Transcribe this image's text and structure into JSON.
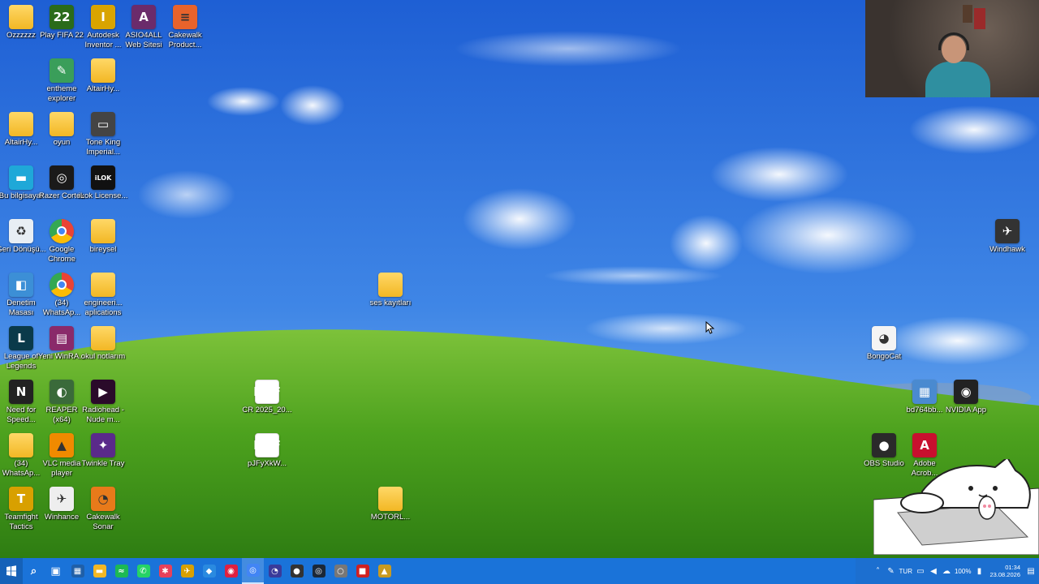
{
  "desktop": {
    "icons": [
      {
        "id": "ozzzzzz",
        "label": "Ozzzzzz",
        "icon": "folder-icon",
        "kind": "folder"
      },
      {
        "id": "fifa22",
        "label": "Play FIFA 22",
        "icon": "fifa-22-icon",
        "glyph": "22",
        "color": "#2a6b1a"
      },
      {
        "id": "autodesk",
        "label": "Autodesk Inventor ...",
        "icon": "autodesk-inventor-icon",
        "glyph": "I",
        "color": "#d9a400"
      },
      {
        "id": "asio4all",
        "label": "ASIO4ALL Web Sitesi",
        "icon": "asio4all-icon",
        "glyph": "A",
        "color": "#6b2b6b"
      },
      {
        "id": "cakewalk-product",
        "label": "Cakewalk Product...",
        "icon": "cakewalk-product-center-icon",
        "glyph": "≡",
        "color": "#e8632b"
      },
      {
        "id": "entheme",
        "label": "entheme explorer",
        "icon": "explorer-icon",
        "glyph": "✎",
        "color": "#3a9e5a"
      },
      {
        "id": "altair-hy-1",
        "label": "AltairHy...",
        "icon": "folder-icon",
        "kind": "folder"
      },
      {
        "id": "altair-hy-2",
        "label": "AltairHy...",
        "icon": "folder-icon",
        "kind": "folder"
      },
      {
        "id": "oyun",
        "label": "oyun",
        "icon": "folder-icon",
        "kind": "folder"
      },
      {
        "id": "toneking",
        "label": "Tone King Imperial...",
        "icon": "tone-king-amp-icon",
        "glyph": "▭",
        "color": "#444"
      },
      {
        "id": "bu-bilgisayar",
        "label": "Bu bilgisayar",
        "icon": "this-pc-icon",
        "glyph": "▬",
        "color": "#1fa8d8"
      },
      {
        "id": "razer",
        "label": "Razer Cortex",
        "icon": "razer-cortex-icon",
        "glyph": "◎",
        "color": "#1a1a1a"
      },
      {
        "id": "ilok",
        "label": "iLok License...",
        "icon": "ilok-icon",
        "glyph": "iLOK",
        "color": "#111"
      },
      {
        "id": "geri",
        "label": "Geri Dönüşü...",
        "icon": "recycle-bin-icon",
        "glyph": "♻",
        "color": "#e8eef4"
      },
      {
        "id": "chrome",
        "label": "Google Chrome",
        "icon": "chrome-icon",
        "kind": "chrome"
      },
      {
        "id": "bireysel",
        "label": "bireysel",
        "icon": "folder-icon",
        "kind": "folder"
      },
      {
        "id": "denetim",
        "label": "Denetim Masası",
        "icon": "control-panel-icon",
        "glyph": "◧",
        "color": "#3c8fd6"
      },
      {
        "id": "whatsapp-34",
        "label": "(34) WhatsAp...",
        "icon": "chrome-app-icon",
        "kind": "chrome"
      },
      {
        "id": "engineering",
        "label": "engineeri... aplications",
        "icon": "folder-icon",
        "kind": "folder"
      },
      {
        "id": "lol",
        "label": "League of Legends",
        "icon": "league-of-legends-icon",
        "glyph": "L",
        "color": "#0a3a4a"
      },
      {
        "id": "winrar",
        "label": "Yeni WinRA...",
        "icon": "winrar-icon",
        "glyph": "▤",
        "color": "#8a2a6a"
      },
      {
        "id": "okul",
        "label": "okul notlarım",
        "icon": "folder-icon",
        "kind": "folder"
      },
      {
        "id": "nfs",
        "label": "Need for Speed...",
        "icon": "need-for-speed-icon",
        "glyph": "N",
        "color": "#222"
      },
      {
        "id": "reaper",
        "label": "REAPER (x64)",
        "icon": "reaper-icon",
        "glyph": "◐",
        "color": "#3a6a3a"
      },
      {
        "id": "radiohead",
        "label": "Radiohead - Nude m...",
        "icon": "video-file-icon",
        "glyph": "▶",
        "color": "#2a0a2a"
      },
      {
        "id": "whatsapp-34b",
        "label": "(34) WhatsAp...",
        "icon": "folder-icon",
        "kind": "folder"
      },
      {
        "id": "vlc",
        "label": "VLC media player",
        "icon": "vlc-icon",
        "glyph": "▲",
        "color": "#f08a00"
      },
      {
        "id": "twinkle",
        "label": "Twinkle Tray",
        "icon": "twinkle-tray-icon",
        "glyph": "✦",
        "color": "#5a2a8a"
      },
      {
        "id": "tft",
        "label": "Teamfight Tactics",
        "icon": "teamfight-tactics-icon",
        "glyph": "T",
        "color": "#d8a000"
      },
      {
        "id": "winhance",
        "label": "Winhance",
        "icon": "winhance-icon",
        "glyph": "✈",
        "color": "#eee"
      },
      {
        "id": "cakewalk-sonar",
        "label": "Cakewalk Sonar",
        "icon": "cakewalk-sonar-icon",
        "glyph": "◔",
        "color": "#e87a1a"
      },
      {
        "id": "ses",
        "label": "ses kayıtları",
        "icon": "folder-icon",
        "kind": "folder"
      },
      {
        "id": "cr",
        "label": "CR 2025_20...",
        "icon": "pdf-icon",
        "kind": "pdf"
      },
      {
        "id": "pjfy",
        "label": "pJFyXkW...",
        "icon": "pdf-icon",
        "kind": "pdf"
      },
      {
        "id": "motorl",
        "label": "MOTORL...",
        "icon": "folder-zip-icon",
        "kind": "folder"
      },
      {
        "id": "windhawk",
        "label": "Windhawk",
        "icon": "windhawk-icon",
        "glyph": "✈",
        "color": "#333"
      },
      {
        "id": "bongocat",
        "label": "BongoCat",
        "icon": "bongo-cat-icon",
        "glyph": "◕",
        "color": "#f4f4f4"
      },
      {
        "id": "bd764",
        "label": "bd764bb...",
        "icon": "image-file-icon",
        "glyph": "▦",
        "color": "#4a8ad0"
      },
      {
        "id": "nvidia",
        "label": "NVIDIA App",
        "icon": "nvidia-icon",
        "glyph": "◉",
        "color": "#222"
      },
      {
        "id": "obs",
        "label": "OBS Studio",
        "icon": "obs-icon",
        "glyph": "●",
        "color": "#2a2a2a"
      },
      {
        "id": "adobe",
        "label": "Adobe Acrob...",
        "icon": "adobe-acrobat-icon",
        "glyph": "A",
        "color": "#c8102e"
      }
    ]
  },
  "taskbar": {
    "items": [
      {
        "id": "search",
        "icon": "search-icon",
        "glyph": "⌕",
        "color": "transparent"
      },
      {
        "id": "taskview",
        "icon": "task-view-icon",
        "glyph": "▣",
        "color": "transparent"
      },
      {
        "id": "store",
        "icon": "microsoft-store-icon",
        "glyph": "▦",
        "color": "#1f5fa8"
      },
      {
        "id": "explorer",
        "icon": "file-explorer-icon",
        "glyph": "▬",
        "color": "#f2b724"
      },
      {
        "id": "spotify",
        "icon": "spotify-icon",
        "glyph": "≈",
        "color": "#1db954"
      },
      {
        "id": "whatsapp",
        "icon": "whatsapp-icon",
        "glyph": "✆",
        "color": "#25d366"
      },
      {
        "id": "app-red",
        "icon": "colorful-app-icon",
        "glyph": "✱",
        "color": "#e8415a"
      },
      {
        "id": "app-winhance",
        "icon": "winhance-taskbar-icon",
        "glyph": "✈",
        "color": "#d8a000"
      },
      {
        "id": "app-blue",
        "icon": "blue-app-icon",
        "glyph": "◆",
        "color": "#2a8ae0"
      },
      {
        "id": "app-record",
        "icon": "record-app-icon",
        "glyph": "◉",
        "color": "#e02040"
      },
      {
        "id": "chrome",
        "icon": "chrome-taskbar-icon",
        "glyph": "◎",
        "color": "#4285f4"
      },
      {
        "id": "app-cake",
        "icon": "cakewalk-taskbar-icon",
        "glyph": "◔",
        "color": "#3a3a9a"
      },
      {
        "id": "app-obs",
        "icon": "obs-taskbar-icon",
        "glyph": "●",
        "color": "#333"
      },
      {
        "id": "steam",
        "icon": "steam-icon",
        "glyph": "◎",
        "color": "#1b2838"
      },
      {
        "id": "app-gray",
        "icon": "circle-app-icon",
        "glyph": "○",
        "color": "#777"
      },
      {
        "id": "app-red2",
        "icon": "red-app-icon",
        "glyph": "■",
        "color": "#d02020"
      },
      {
        "id": "app-yellow",
        "icon": "audio-app-icon",
        "glyph": "▲",
        "color": "#c89a20"
      }
    ],
    "tray": {
      "language": "TUR",
      "battery_label": "100%",
      "time": "01:34",
      "date": "23.08.2026"
    }
  }
}
